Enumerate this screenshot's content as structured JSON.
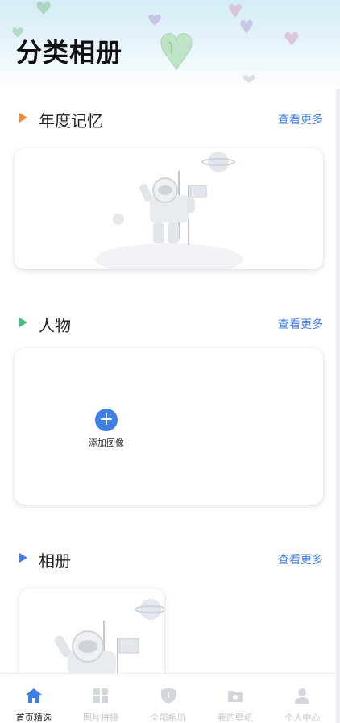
{
  "page": {
    "title": "分类相册"
  },
  "sections": [
    {
      "title": "年度记忆",
      "more_label": "查看更多",
      "marker_color": "#f08a3c"
    },
    {
      "title": "人物",
      "more_label": "查看更多",
      "marker_color": "#3cc07a"
    },
    {
      "title": "相册",
      "more_label": "查看更多",
      "marker_color": "#3f7fe6"
    }
  ],
  "people_card": {
    "add_icon": "plus-icon",
    "add_label": "添加图像"
  },
  "bottom_nav": {
    "items": [
      {
        "label": "首页精选",
        "icon": "home-icon",
        "active": true
      },
      {
        "label": "图片拼接",
        "icon": "grid-icon",
        "active": false
      },
      {
        "label": "全部相册",
        "icon": "shield-icon",
        "active": false
      },
      {
        "label": "我的壁纸",
        "icon": "folder-icon",
        "active": false
      },
      {
        "label": "个人中心",
        "icon": "user-icon",
        "active": false
      }
    ]
  },
  "colors": {
    "accent": "#3f7fe6",
    "inactive": "#c3c7cc"
  }
}
